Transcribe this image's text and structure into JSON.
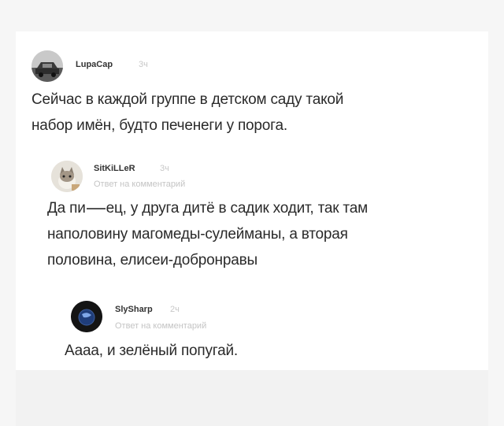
{
  "comments": [
    {
      "author": "LupaCap",
      "time": "3ч",
      "avatar_icon": "car-photo-avatar",
      "lines": [
        "Сейчас в каждой группе в детском саду такой",
        "набор имён, будто печенеги у порога."
      ]
    },
    {
      "author": "SitKiLLeR",
      "time": "3ч",
      "avatar_icon": "cat-photo-avatar",
      "reply_label": "Ответ на комментарий",
      "line1_prefix": "Да пи",
      "line1_suffix": "ец, у друга дитё в садик ходит, так там",
      "lines": [
        "наполовину магомеды-сулейманы, а вторая",
        "половина, елисеи-добронравы"
      ]
    },
    {
      "author": "SlySharp",
      "time": "2ч",
      "avatar_icon": "dark-planet-avatar",
      "reply_label": "Ответ на комментарий",
      "lines": [
        "Аааа, и зелёный попугай."
      ]
    }
  ],
  "colors": {
    "background": "#f6f6f6",
    "card": "#ffffff",
    "text": "#2a2a2a",
    "muted": "#c4c4c4"
  }
}
